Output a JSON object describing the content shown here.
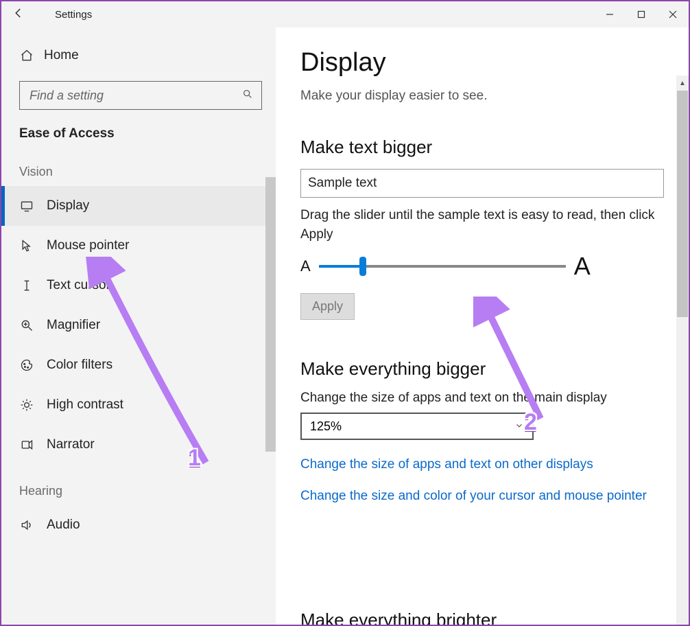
{
  "titlebar": {
    "title": "Settings"
  },
  "sidebar": {
    "home_label": "Home",
    "search_placeholder": "Find a setting",
    "section_label": "Ease of Access",
    "groups": {
      "vision": {
        "label": "Vision",
        "items": [
          {
            "id": "display",
            "label": "Display",
            "icon": "monitor-icon",
            "active": true
          },
          {
            "id": "mouse-pointer",
            "label": "Mouse pointer",
            "icon": "cursor-icon",
            "active": false
          },
          {
            "id": "text-cursor",
            "label": "Text cursor",
            "icon": "text-cursor-icon",
            "active": false
          },
          {
            "id": "magnifier",
            "label": "Magnifier",
            "icon": "magnifier-icon",
            "active": false
          },
          {
            "id": "color-filters",
            "label": "Color filters",
            "icon": "palette-icon",
            "active": false
          },
          {
            "id": "high-contrast",
            "label": "High contrast",
            "icon": "brightness-icon",
            "active": false
          },
          {
            "id": "narrator",
            "label": "Narrator",
            "icon": "narrator-icon",
            "active": false
          }
        ]
      },
      "hearing": {
        "label": "Hearing",
        "items": [
          {
            "id": "audio",
            "label": "Audio",
            "icon": "speaker-icon",
            "active": false
          }
        ]
      }
    }
  },
  "content": {
    "title": "Display",
    "subtitle": "Make your display easier to see.",
    "make_text_bigger": {
      "heading": "Make text bigger",
      "sample_text": "Sample text",
      "slider_desc": "Drag the slider until the sample text is easy to read, then click Apply",
      "small_label": "A",
      "big_label": "A",
      "slider_percent": 18,
      "apply_label": "Apply"
    },
    "make_everything_bigger": {
      "heading": "Make everything bigger",
      "dropdown_label": "Change the size of apps and text on the main display",
      "dropdown_value": "125%",
      "link_other_displays": "Change the size of apps and text on other displays",
      "link_cursor": "Change the size and color of your cursor and mouse pointer"
    },
    "next_section_partial": "Make everything brighter"
  },
  "annotations": {
    "num1": "1",
    "num2": "2"
  }
}
